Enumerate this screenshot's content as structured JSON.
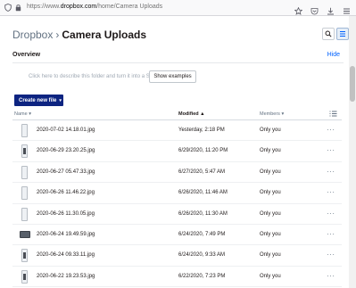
{
  "browser": {
    "url_prefix": "https://www.",
    "url_host": "dropbox.com",
    "url_path": "/home/Camera Uploads",
    "icons": [
      "shield-icon",
      "lock-icon",
      "bookmark-star-icon",
      "pocket-icon",
      "download-icon",
      "menu-icon"
    ]
  },
  "header": {
    "breadcrumb_root": "Dropbox",
    "breadcrumb_separator": "›",
    "title": "Camera Uploads",
    "icons": [
      "search-icon",
      "list-view-icon"
    ]
  },
  "overview": {
    "title": "Overview",
    "hide_label": "Hide",
    "describe_text": "Click here to describe this folder and turn it into a Space",
    "show_examples_label": "Show examples"
  },
  "create": {
    "label": "Create new file",
    "caret": "▾"
  },
  "table": {
    "columns": {
      "name": "Name ▾",
      "modified": "Modified ▲",
      "members": "Members ▾"
    },
    "view_icon": "list-view-icon",
    "rows": [
      {
        "name": "2020-07-02 14.18.01.jpg",
        "modified": "Yesterday, 2:18 PM",
        "members": "Only you",
        "thumb": "portrait"
      },
      {
        "name": "2020-06-29 23.20.25.jpg",
        "modified": "6/29/2020, 11:20 PM",
        "members": "Only you",
        "thumb": "portrait-dark"
      },
      {
        "name": "2020-06-27 05.47.33.jpg",
        "modified": "6/27/2020, 5:47 AM",
        "members": "Only you",
        "thumb": "portrait"
      },
      {
        "name": "2020-06-26 11.46.22.jpg",
        "modified": "6/26/2020, 11:46 AM",
        "members": "Only you",
        "thumb": "portrait"
      },
      {
        "name": "2020-06-26 11.30.05.jpg",
        "modified": "6/26/2020, 11:30 AM",
        "members": "Only you",
        "thumb": "portrait"
      },
      {
        "name": "2020-06-24 19.49.59.jpg",
        "modified": "6/24/2020, 7:49 PM",
        "members": "Only you",
        "thumb": "landscape"
      },
      {
        "name": "2020-06-24 09.33.11.jpg",
        "modified": "6/24/2020, 9:33 AM",
        "members": "Only you",
        "thumb": "portrait-dark"
      },
      {
        "name": "2020-06-22 19.23.53.jpg",
        "modified": "6/22/2020, 7:23 PM",
        "members": "Only you",
        "thumb": "portrait-dark"
      }
    ],
    "more_label": "···"
  },
  "colors": {
    "accent": "#0061fe",
    "create_button": "#0d2481"
  }
}
